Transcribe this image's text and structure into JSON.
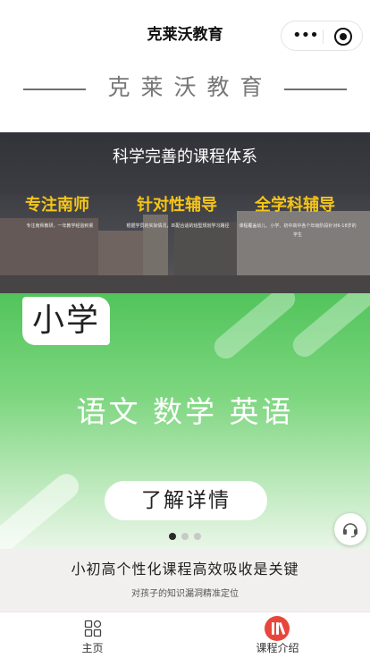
{
  "navbar": {
    "title": "克莱沃教育",
    "more_icon": "more-dots-icon",
    "close_icon": "close-circle-icon"
  },
  "brand": {
    "text": "克莱沃教育"
  },
  "feature_banner": {
    "title": "科学完善的课程体系",
    "pillars": [
      {
        "title": "专注南师",
        "desc": "专注南师教研，一年教学经验积累"
      },
      {
        "title": "针对性辅导",
        "desc": "根据学员的实际情况，匹配合适的班型规划学习路径"
      },
      {
        "title": "全学科辅导",
        "desc": "课程覆盖幼儿、小学、初中高中各个年级阶段针对6-18岁的学生"
      }
    ],
    "accent_color": "#f5c518"
  },
  "carousel": {
    "grade": "小学",
    "subjects": "语文 数学 英语",
    "cta_label": "了解详情",
    "slide_count": 3,
    "active_index": 0,
    "bg_color": "#52c45b"
  },
  "service": {
    "icon": "headset-icon"
  },
  "tagline": {
    "title": "小初高个性化课程高效吸收是关键",
    "subtitle": "对孩子的知识漏洞精准定位"
  },
  "tabbar": {
    "items": [
      {
        "label": "主页",
        "icon": "home-grid-icon",
        "active": false
      },
      {
        "label": "课程介绍",
        "icon": "course-books-icon",
        "active": true
      }
    ],
    "active_color": "#e8463c"
  }
}
